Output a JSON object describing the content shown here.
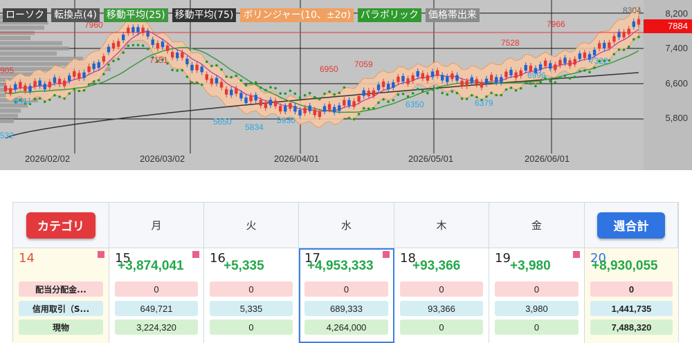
{
  "chart": {
    "legend": [
      {
        "label": "ローソク",
        "color": "#444444"
      },
      {
        "label": "転換点(4)",
        "color": "#555555"
      },
      {
        "label": "移動平均(25)",
        "color": "#3d9a3d"
      },
      {
        "label": "移動平均(75)",
        "color": "#333333"
      },
      {
        "label": "ボリンジャー(10、±2σ)",
        "color": "#f0a060"
      },
      {
        "label": "パラボリック",
        "color": "#2e9a2e"
      },
      {
        "label": "価格帯出来",
        "color": "#8a8a8a"
      }
    ],
    "y_ticks": [
      "8,200",
      "7,400",
      "6,600",
      "5,800"
    ],
    "x_ticks": [
      "2026/02/02",
      "2026/03/02",
      "2026/04/01",
      "2026/05/01",
      "2026/06/01"
    ],
    "current_price": "7884",
    "high_label": "8304",
    "red_labels": [
      "7960",
      "7151",
      "6950",
      "7059",
      "7528",
      "7966",
      "905"
    ],
    "blue_labels": [
      "6411",
      "5650",
      "5834",
      "5930",
      "6350",
      "6379",
      "6996",
      "7322",
      "532"
    ],
    "colors": {
      "up": "#e53935",
      "down": "#1e63d0",
      "band": "#f7c9a4",
      "ma25": "#3d9a3d",
      "ma75": "#333333",
      "ma_short": "#b03aa8",
      "sar": "#1f9a1f"
    }
  },
  "table": {
    "category_button": "カテゴリ",
    "weekly_button": "週合計",
    "weekday_headers": [
      "月",
      "火",
      "水",
      "木",
      "金"
    ],
    "category": {
      "day": "14",
      "rows": [
        "配当分配金...",
        "信用取引（S...",
        "現物"
      ]
    },
    "days": [
      {
        "day": "15",
        "total": "+3,874,041",
        "values": [
          "0",
          "649,721",
          "3,224,320"
        ]
      },
      {
        "day": "16",
        "total": "+5,335",
        "values": [
          "0",
          "5,335",
          "0"
        ]
      },
      {
        "day": "17",
        "total": "+4,953,333",
        "values": [
          "0",
          "689,333",
          "4,264,000"
        ]
      },
      {
        "day": "18",
        "total": "+93,366",
        "values": [
          "0",
          "93,366",
          "0"
        ]
      },
      {
        "day": "19",
        "total": "+3,980",
        "values": [
          "0",
          "3,980",
          "0"
        ]
      }
    ],
    "weekly": {
      "day": "20",
      "total": "+8,930,055",
      "values": [
        "0",
        "1,441,735",
        "7,488,320"
      ]
    }
  }
}
